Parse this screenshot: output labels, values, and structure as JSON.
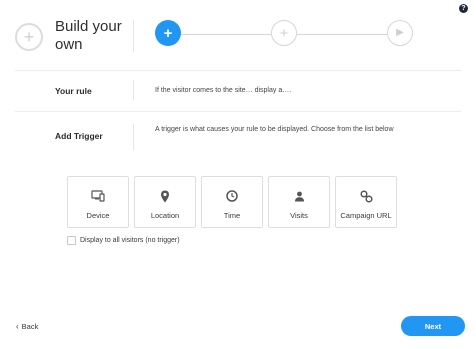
{
  "help": {
    "glyph": "?"
  },
  "header": {
    "icon": "plus-circle-icon",
    "title": "Build your own",
    "steps": [
      {
        "glyph": "+",
        "state": "active",
        "icon": "plus-icon"
      },
      {
        "glyph": "+",
        "state": "inactive",
        "icon": "plus-icon"
      },
      {
        "glyph": "▶",
        "state": "inactive",
        "icon": "play-icon"
      }
    ]
  },
  "rows": {
    "rule": {
      "label": "Your rule",
      "text": "If the visitor comes to the site… display a…."
    },
    "trigger": {
      "label": "Add Trigger",
      "text": "A trigger is what causes your rule to be displayed. Choose from the list below"
    }
  },
  "triggers": [
    {
      "label": "Device",
      "icon": "device-icon"
    },
    {
      "label": "Location",
      "icon": "location-pin-icon"
    },
    {
      "label": "Time",
      "icon": "clock-icon"
    },
    {
      "label": "Visits",
      "icon": "person-icon"
    },
    {
      "label": "Campaign URL",
      "icon": "link-icon"
    }
  ],
  "all_visitors": {
    "label": "Display to all visitors (no trigger)",
    "checked": false
  },
  "footer": {
    "back_label": "Back",
    "next_label": "Next"
  },
  "colors": {
    "accent": "#2196f3",
    "border": "#dedede",
    "text": "#333333"
  }
}
